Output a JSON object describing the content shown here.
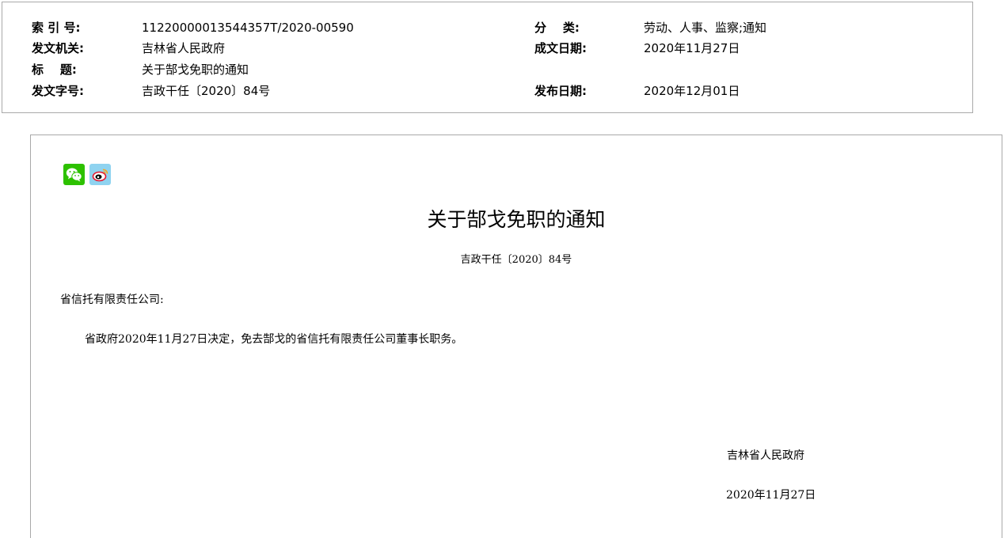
{
  "metadata": {
    "index_label": "索 引 号:",
    "index_value": "11220000013544357T/2020-00590",
    "category_label": "分    类:",
    "category_value": "劳动、人事、监察;通知",
    "issuer_label": "发文机关:",
    "issuer_value": "吉林省人民政府",
    "created_date_label": "成文日期:",
    "created_date_value": "2020年11月27日",
    "title_label": "标    题:",
    "title_value": "关于郜戈免职的通知",
    "doc_number_label": "发文字号:",
    "doc_number_value": "吉政干任〔2020〕84号",
    "publish_date_label": "发布日期:",
    "publish_date_value": "2020年12月01日"
  },
  "share": {
    "wechat_icon": "wechat-icon",
    "weibo_icon": "weibo-icon",
    "wechat_color": "#2dc100",
    "weibo_color": "#e6162d"
  },
  "document": {
    "title": "关于郜戈免职的通知",
    "number": "吉政干任〔2020〕84号",
    "recipient": "省信托有限责任公司:",
    "paragraph": "省政府2020年11月27日决定，免去郜戈的省信托有限责任公司董事长职务。",
    "signature": "吉林省人民政府",
    "date": "2020年11月27日"
  }
}
